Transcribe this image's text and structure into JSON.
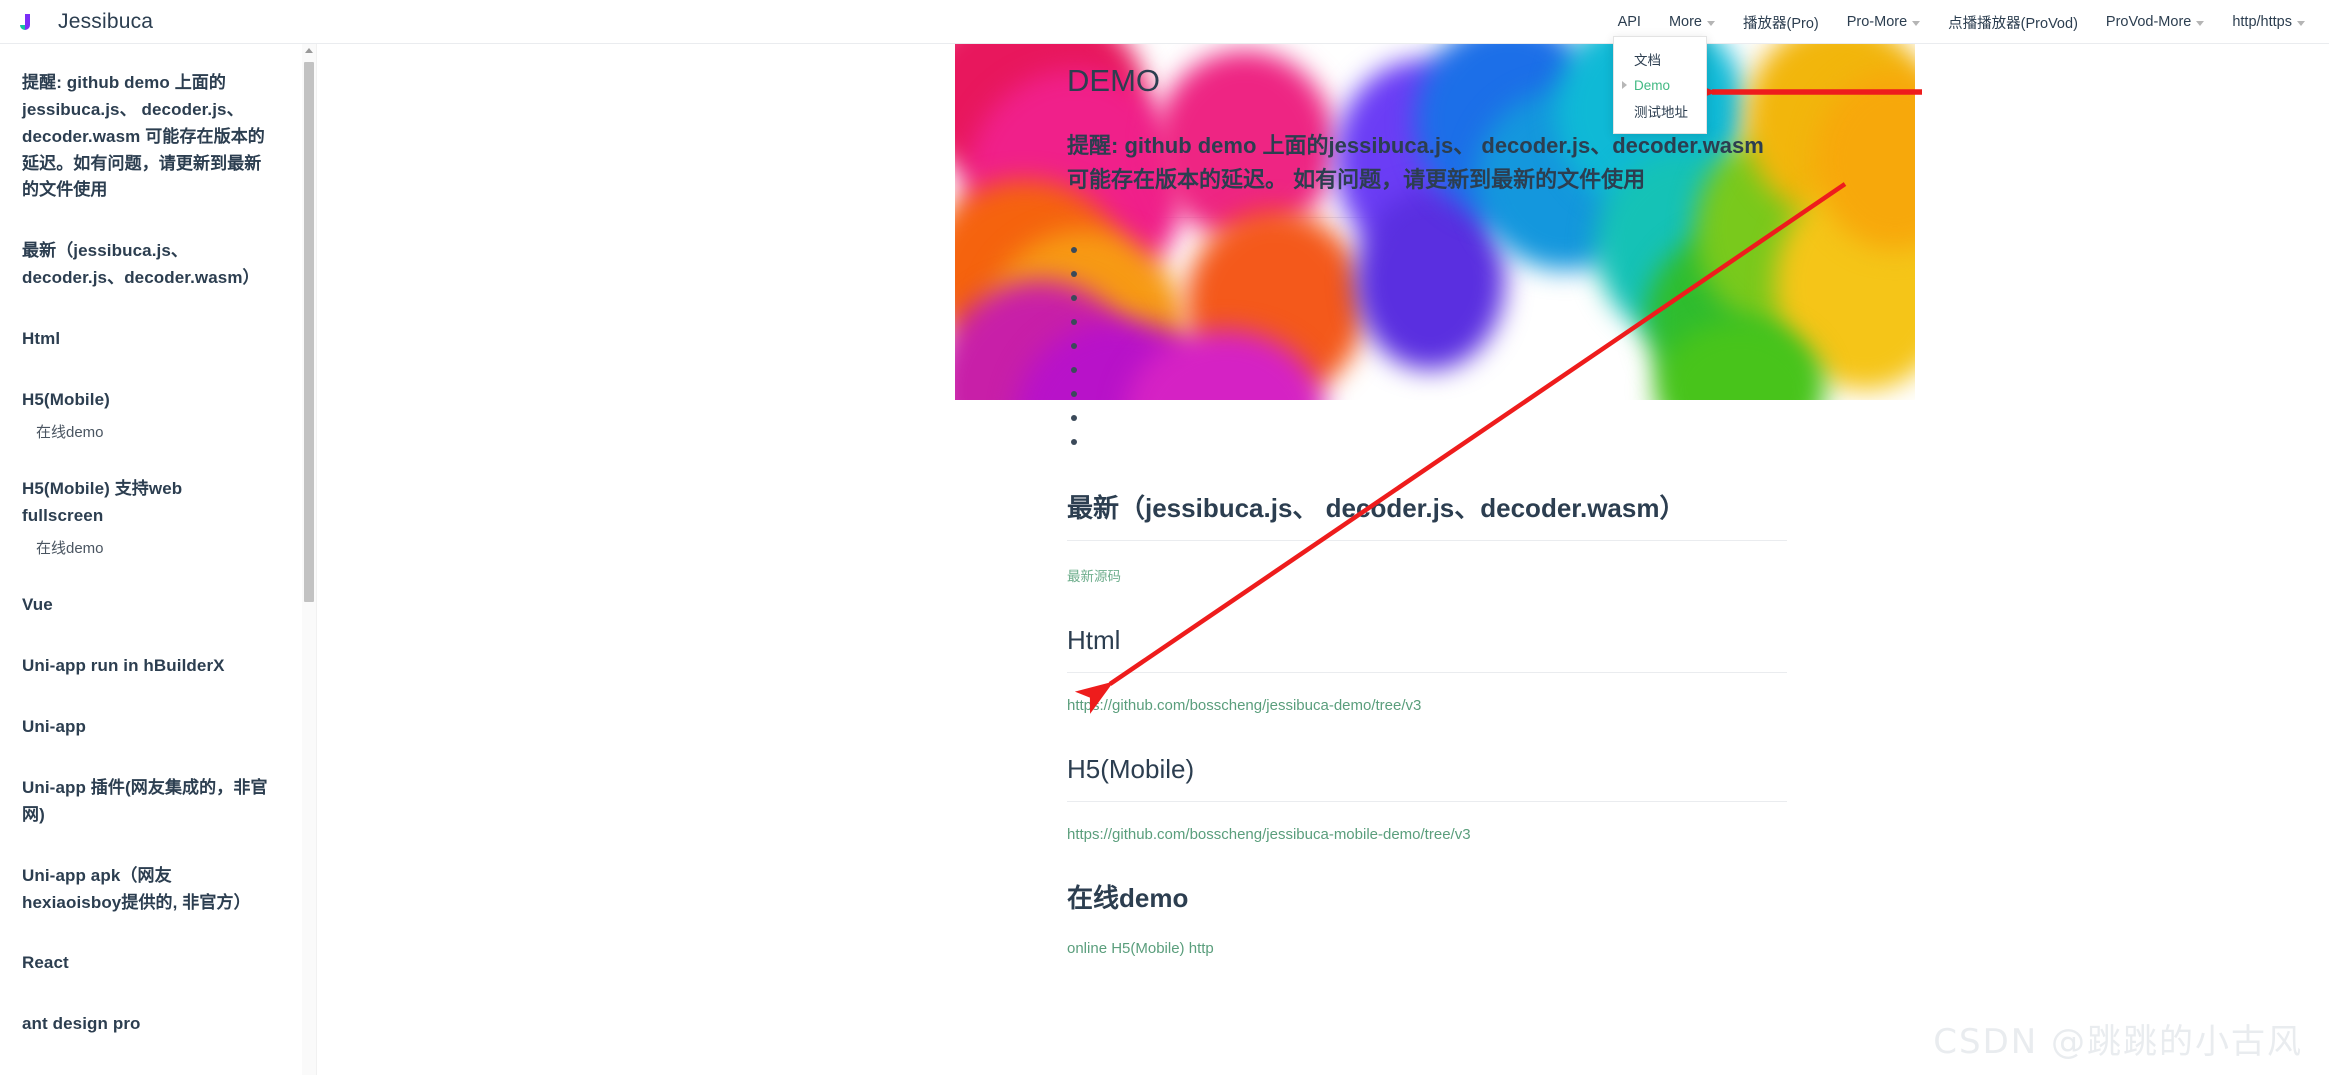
{
  "header": {
    "brand": "Jessibuca",
    "logo_icon": "jessibuca-logo-icon",
    "nav": [
      {
        "label": "API",
        "caret": false
      },
      {
        "label": "More",
        "caret": true
      },
      {
        "label": "播放器(Pro)",
        "caret": false
      },
      {
        "label": "Pro-More",
        "caret": true
      },
      {
        "label": "点播播放器(ProVod)",
        "caret": false
      },
      {
        "label": "ProVod-More",
        "caret": true
      },
      {
        "label": "http/https",
        "caret": true
      }
    ]
  },
  "dropdown": {
    "items": [
      {
        "label": "文档",
        "active": false,
        "bullet": false
      },
      {
        "label": "Demo",
        "active": true,
        "bullet": true
      },
      {
        "label": "测试地址",
        "active": false,
        "bullet": false
      }
    ],
    "active_color": "#42b983"
  },
  "sidebar": {
    "items": [
      {
        "type": "heading",
        "label": "提醒: github demo 上面的jessibuca.js、 decoder.js、decoder.wasm 可能存在版本的延迟。如有问题，请更新到最新的文件使用"
      },
      {
        "type": "heading",
        "label": "最新（jessibuca.js、decoder.js、decoder.wasm）"
      },
      {
        "type": "heading",
        "label": "Html"
      },
      {
        "type": "heading",
        "label": "H5(Mobile)"
      },
      {
        "type": "sub",
        "label": "在线demo"
      },
      {
        "type": "heading",
        "label": "H5(Mobile) 支持web fullscreen"
      },
      {
        "type": "sub",
        "label": "在线demo"
      },
      {
        "type": "heading",
        "label": "Vue"
      },
      {
        "type": "heading",
        "label": "Uni-app run in hBuilderX"
      },
      {
        "type": "heading",
        "label": "Uni-app"
      },
      {
        "type": "heading",
        "label": "Uni-app 插件(网友集成的，非官网)"
      },
      {
        "type": "heading",
        "label": "Uni-app apk（网友hexiaoisboy提供的, 非官方）"
      },
      {
        "type": "heading",
        "label": "React"
      },
      {
        "type": "heading",
        "label": "ant design pro"
      }
    ]
  },
  "main": {
    "title": "DEMO",
    "lead": "提醒: github demo 上面的jessibuca.js、 decoder.js、decoder.wasm 可能存在版本的延迟。 如有问题，请更新到最新的文件使用",
    "bullet_count": 9,
    "sections": [
      {
        "heading": "最新（jessibuca.js、 decoder.js、decoder.wasm）",
        "heading_weight": "bold",
        "link": "最新源码",
        "link_size": "small"
      },
      {
        "heading": "Html",
        "heading_weight": "light",
        "link": "https://github.com/bosscheng/jessibuca-demo/tree/v3",
        "link_size": "normal"
      },
      {
        "heading": "H5(Mobile)",
        "heading_weight": "light",
        "link": "https://github.com/bosscheng/jessibuca-mobile-demo/tree/v3",
        "link_size": "normal"
      },
      {
        "heading": "在线demo",
        "heading_weight": "bold",
        "link": "online H5(Mobile) http",
        "link_size": "normal"
      }
    ]
  },
  "annotations": {
    "arrow_color": "#ee1c1c",
    "arrow_to_demo_menu": "red-arrow-pointing-to-demo-menu-item",
    "arrow_to_source_link": "red-arrow-pointing-to-latest-source-link"
  },
  "watermark": {
    "text": "CSDN @跳跳的小古风"
  }
}
